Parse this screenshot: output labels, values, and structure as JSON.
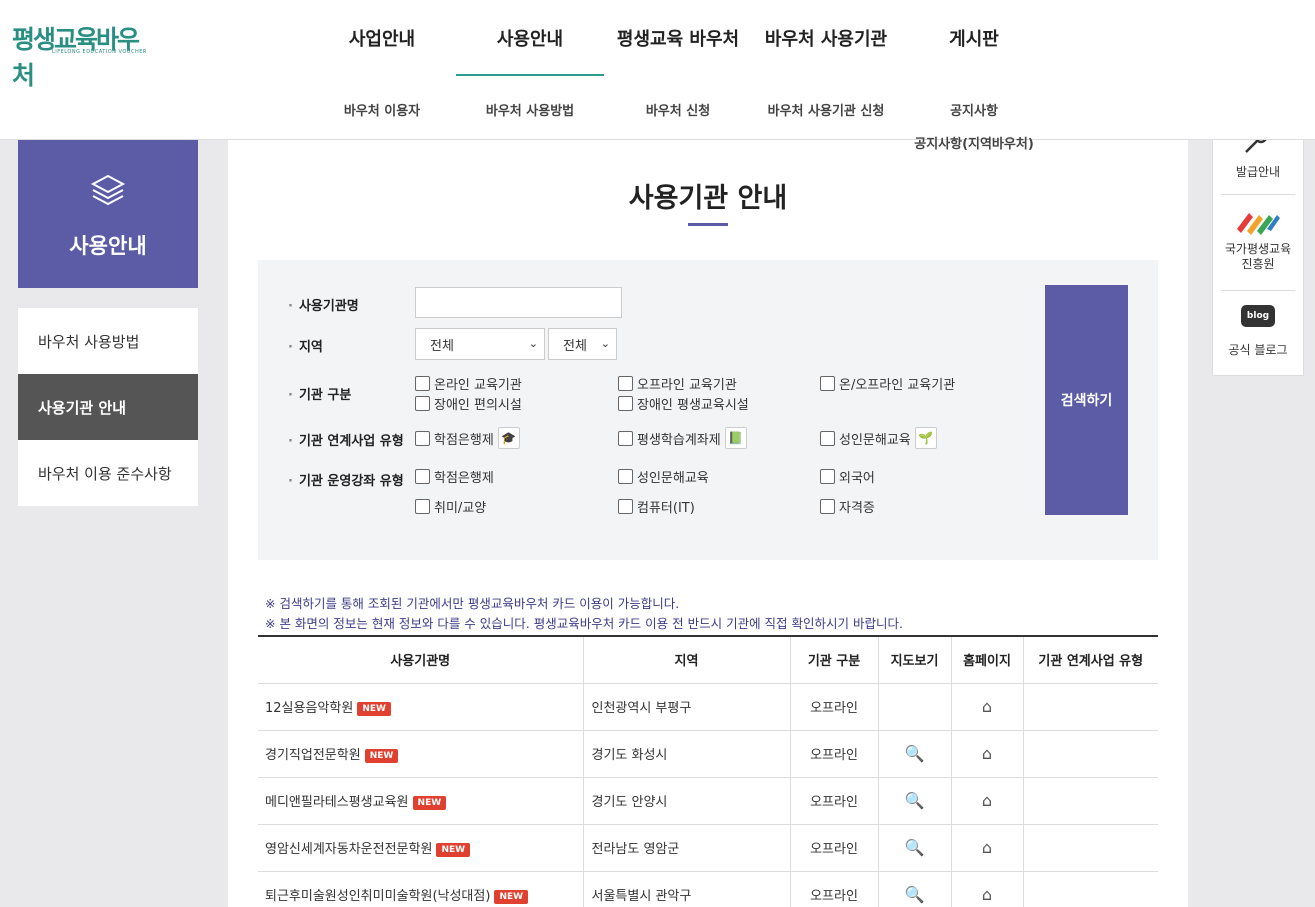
{
  "logo": {
    "title": "평생교육바우처",
    "subtitle": "LIFELONG EDUCATION VOUCHER"
  },
  "gnb": [
    "사업안내",
    "사용안내",
    "평생교육 바우처",
    "바우처 사용기관",
    "게시판"
  ],
  "sub_nav": {
    "col1": [
      "바우처 이용자"
    ],
    "col2": [
      "바우처 사용방법"
    ],
    "col3": [
      "바우처 신청"
    ],
    "col4": [
      "바우처 사용기관 신청"
    ],
    "col5": [
      "공지사항",
      "공지사항(지역바우처)"
    ]
  },
  "lnb": {
    "title": "사용안내",
    "items": [
      "바우처 사용방법",
      "사용기관 안내",
      "바우처 이용 준수사항"
    ]
  },
  "quick": [
    "발급안내",
    "국가평생교육\n진흥원",
    "공식 블로그"
  ],
  "quick_blog_badge": "blog",
  "page_title": "사용기관 안내",
  "search": {
    "label_name": "사용기관명",
    "label_region": "지역",
    "label_type": "기관 구분",
    "label_link": "기관 연계사업 유형",
    "label_course": "기관 운영강좌 유형",
    "region1": "전체",
    "region2": "전체",
    "types": [
      "온라인 교육기관",
      "오프라인 교육기관",
      "온/오프라인 교육기관",
      "장애인 편의시설",
      "장애인 평생교육시설"
    ],
    "links": [
      "학점은행제",
      "평생학습계좌제",
      "성인문해교육"
    ],
    "courses": [
      "학점은행제",
      "성인문해교육",
      "외국어",
      "취미/교양",
      "컴퓨터(IT)",
      "자격증"
    ],
    "button": "검색하기"
  },
  "notices": [
    "※ 검색하기를 통해 조회된 기관에서만 평생교육바우처 카드 이용이 가능합니다.",
    "※ 본 화면의 정보는 현재 정보와 다를 수 있습니다. 평생교육바우처 카드 이용 전 반드시 기관에 직접 확인하시기 바랍니다."
  ],
  "table": {
    "headers": [
      "사용기관명",
      "지역",
      "기관 구분",
      "지도보기",
      "홈페이지",
      "기관 연계사업 유형"
    ],
    "new_badge": "NEW",
    "rows": [
      {
        "name": "12실용음악학원",
        "region": "인천광역시 부평구",
        "type": "오프라인"
      },
      {
        "name": "경기직업전문학원",
        "region": "경기도 화성시",
        "type": "오프라인"
      },
      {
        "name": "메디앤필라테스평생교육원",
        "region": "경기도 안양시",
        "type": "오프라인"
      },
      {
        "name": "영암신세계자동차운전전문학원",
        "region": "전라남도 영암군",
        "type": "오프라인"
      },
      {
        "name": "퇴근후미술원성인취미미술학원(낙성대점)",
        "region": "서울특별시 관악구",
        "type": "오프라인"
      }
    ]
  },
  "colors": {
    "accent": "#5b5ba6",
    "teal": "#2a9d8f",
    "new": "#e0402f"
  }
}
